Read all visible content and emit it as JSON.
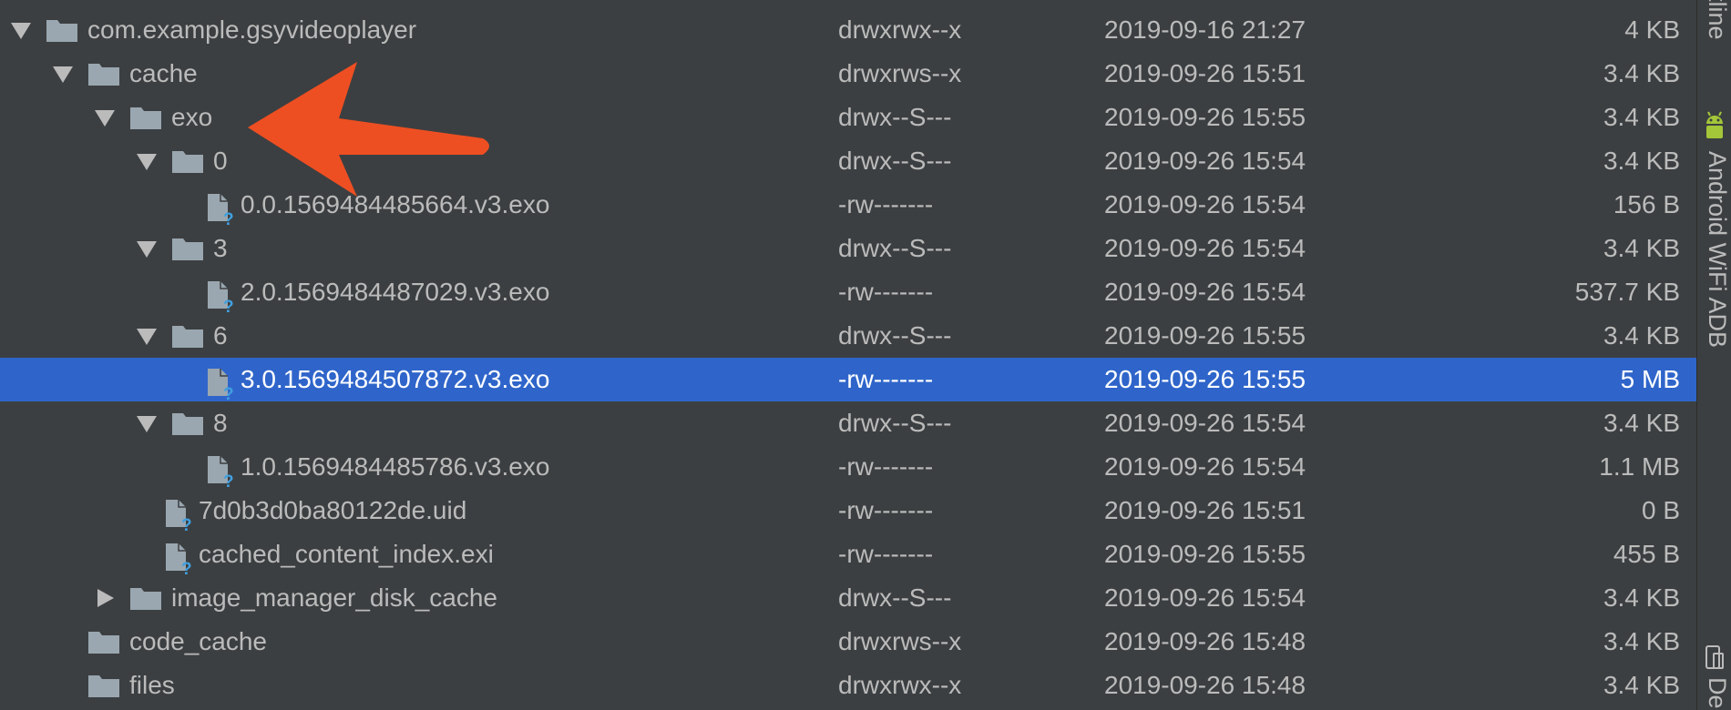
{
  "colors": {
    "background": "#3c3f41",
    "text": "#bbbbbb",
    "selection": "#2f65ca",
    "folder": "#9aa7b0",
    "file_badge": "#40a0e0",
    "annotation_arrow": "#ee4f22",
    "android_green": "#a4c639"
  },
  "columns": [
    "name",
    "permissions",
    "date",
    "size"
  ],
  "rows": [
    {
      "name": "com.example.gsyvideoplayer",
      "permissions": "drwxrwx--x",
      "date": "2019-09-16 21:27",
      "size": "4 KB",
      "icon": "folder-icon",
      "expanded": true
    },
    {
      "name": "cache",
      "permissions": "drwxrws--x",
      "date": "2019-09-26 15:51",
      "size": "3.4 KB",
      "icon": "folder-icon",
      "expanded": true
    },
    {
      "name": "exo",
      "permissions": "drwx--S---",
      "date": "2019-09-26 15:55",
      "size": "3.4 KB",
      "icon": "folder-icon",
      "expanded": true
    },
    {
      "name": "0",
      "permissions": "drwx--S---",
      "date": "2019-09-26 15:54",
      "size": "3.4 KB",
      "icon": "folder-icon",
      "expanded": true
    },
    {
      "name": "0.0.1569484485664.v3.exo",
      "permissions": "-rw-------",
      "date": "2019-09-26 15:54",
      "size": "156 B",
      "icon": "unknown-file-icon"
    },
    {
      "name": "3",
      "permissions": "drwx--S---",
      "date": "2019-09-26 15:54",
      "size": "3.4 KB",
      "icon": "folder-icon",
      "expanded": true
    },
    {
      "name": "2.0.1569484487029.v3.exo",
      "permissions": "-rw-------",
      "date": "2019-09-26 15:54",
      "size": "537.7 KB",
      "icon": "unknown-file-icon"
    },
    {
      "name": "6",
      "permissions": "drwx--S---",
      "date": "2019-09-26 15:55",
      "size": "3.4 KB",
      "icon": "folder-icon",
      "expanded": true
    },
    {
      "name": "3.0.1569484507872.v3.exo",
      "permissions": "-rw-------",
      "date": "2019-09-26 15:55",
      "size": "5 MB",
      "icon": "unknown-file-icon",
      "selected": true
    },
    {
      "name": "8",
      "permissions": "drwx--S---",
      "date": "2019-09-26 15:54",
      "size": "3.4 KB",
      "icon": "folder-icon",
      "expanded": true
    },
    {
      "name": "1.0.1569484485786.v3.exo",
      "permissions": "-rw-------",
      "date": "2019-09-26 15:54",
      "size": "1.1 MB",
      "icon": "unknown-file-icon"
    },
    {
      "name": "7d0b3d0ba80122de.uid",
      "permissions": "-rw-------",
      "date": "2019-09-26 15:51",
      "size": "0 B",
      "icon": "unknown-file-icon"
    },
    {
      "name": "cached_content_index.exi",
      "permissions": "-rw-------",
      "date": "2019-09-26 15:55",
      "size": "455 B",
      "icon": "unknown-file-icon"
    },
    {
      "name": "image_manager_disk_cache",
      "permissions": "drwx--S---",
      "date": "2019-09-26 15:54",
      "size": "3.4 KB",
      "icon": "folder-icon",
      "expanded": false
    },
    {
      "name": "code_cache",
      "permissions": "drwxrws--x",
      "date": "2019-09-26 15:48",
      "size": "3.4 KB",
      "icon": "folder-icon"
    },
    {
      "name": "files",
      "permissions": "drwxrwx--x",
      "date": "2019-09-26 15:48",
      "size": "3.4 KB",
      "icon": "folder-icon"
    }
  ],
  "right_strip": {
    "outline_tab": "tline",
    "adb_tab": "Android WiFi ADB",
    "device_tab": "De",
    "android_icon": "android-icon",
    "device_icon": "device-icon"
  }
}
